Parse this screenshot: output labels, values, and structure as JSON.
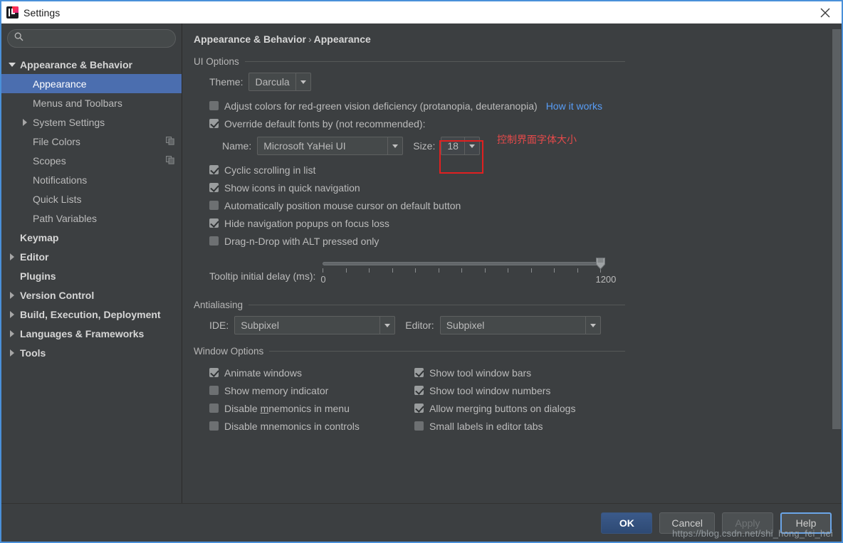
{
  "window": {
    "title": "Settings",
    "app_icon": "intellij-idea-icon",
    "close_icon": "close-icon",
    "accent_border": "#4a90d9"
  },
  "sidebar": {
    "search": {
      "value": "",
      "placeholder": "",
      "icon": "search-icon"
    },
    "items": [
      {
        "label": "Appearance & Behavior",
        "indent": 0,
        "twisty": "down",
        "bold": true,
        "selected": false,
        "icon": null
      },
      {
        "label": "Appearance",
        "indent": 1,
        "twisty": "none",
        "bold": false,
        "selected": true,
        "icon": null
      },
      {
        "label": "Menus and Toolbars",
        "indent": 1,
        "twisty": "none",
        "bold": false,
        "selected": false,
        "icon": null
      },
      {
        "label": "System Settings",
        "indent": 1,
        "twisty": "right",
        "bold": false,
        "selected": false,
        "icon": null
      },
      {
        "label": "File Colors",
        "indent": 1,
        "twisty": "none",
        "bold": false,
        "selected": false,
        "icon": "copy-icon"
      },
      {
        "label": "Scopes",
        "indent": 1,
        "twisty": "none",
        "bold": false,
        "selected": false,
        "icon": "copy-icon"
      },
      {
        "label": "Notifications",
        "indent": 1,
        "twisty": "none",
        "bold": false,
        "selected": false,
        "icon": null
      },
      {
        "label": "Quick Lists",
        "indent": 1,
        "twisty": "none",
        "bold": false,
        "selected": false,
        "icon": null
      },
      {
        "label": "Path Variables",
        "indent": 1,
        "twisty": "none",
        "bold": false,
        "selected": false,
        "icon": null
      },
      {
        "label": "Keymap",
        "indent": 0,
        "twisty": "none",
        "bold": true,
        "selected": false,
        "icon": null
      },
      {
        "label": "Editor",
        "indent": 0,
        "twisty": "right",
        "bold": true,
        "selected": false,
        "icon": null
      },
      {
        "label": "Plugins",
        "indent": 0,
        "twisty": "none",
        "bold": true,
        "selected": false,
        "icon": null
      },
      {
        "label": "Version Control",
        "indent": 0,
        "twisty": "right",
        "bold": true,
        "selected": false,
        "icon": null
      },
      {
        "label": "Build, Execution, Deployment",
        "indent": 0,
        "twisty": "right",
        "bold": true,
        "selected": false,
        "icon": null
      },
      {
        "label": "Languages & Frameworks",
        "indent": 0,
        "twisty": "right",
        "bold": true,
        "selected": false,
        "icon": null
      },
      {
        "label": "Tools",
        "indent": 0,
        "twisty": "right",
        "bold": true,
        "selected": false,
        "icon": null
      }
    ]
  },
  "breadcrumb": {
    "root": "Appearance & Behavior",
    "separator": "›",
    "leaf": "Appearance"
  },
  "ui_options": {
    "group_title": "UI Options",
    "theme_label": "Theme:",
    "theme_value": "Darcula",
    "adjust_colors": {
      "label": "Adjust colors for red-green vision deficiency (protanopia, deuteranopia)",
      "checked": false
    },
    "how_it_works_link": "How it works",
    "override_fonts": {
      "label": "Override default fonts by (not recommended):",
      "checked": true
    },
    "name_label": "Name:",
    "name_value": "Microsoft YaHei UI",
    "size_label": "Size:",
    "size_value": "18",
    "checkboxes": [
      {
        "label": "Cyclic scrolling in list",
        "checked": true,
        "mnemonic": ""
      },
      {
        "label": "Show icons in quick navigation",
        "checked": true,
        "mnemonic": ""
      },
      {
        "label": "Automatically position mouse cursor on default button",
        "checked": false,
        "mnemonic": ""
      },
      {
        "label": "Hide navigation popups on focus loss",
        "checked": true,
        "mnemonic": ""
      },
      {
        "label": "Drag-n-Drop with ALT pressed only",
        "checked": false,
        "mnemonic": ""
      }
    ],
    "tooltip_delay": {
      "label": "Tooltip initial delay (ms):",
      "min": "0",
      "max": "1200",
      "value": 1200
    }
  },
  "antialiasing": {
    "group_title": "Antialiasing",
    "ide_label": "IDE:",
    "ide_value": "Subpixel",
    "editor_label": "Editor:",
    "editor_value": "Subpixel"
  },
  "window_options": {
    "group_title": "Window Options",
    "left_column": [
      {
        "label": "Animate windows",
        "checked": true,
        "mnemonic": ""
      },
      {
        "label": "Show memory indicator",
        "checked": false,
        "mnemonic": ""
      },
      {
        "label": "Disable mnemonics in menu",
        "checked": false,
        "mnemonic": "m"
      },
      {
        "label": "Disable mnemonics in controls",
        "checked": false,
        "mnemonic": ""
      }
    ],
    "right_column": [
      {
        "label": "Show tool window bars",
        "checked": true,
        "mnemonic": ""
      },
      {
        "label": "Show tool window numbers",
        "checked": true,
        "mnemonic": ""
      },
      {
        "label": "Allow merging buttons on dialogs",
        "checked": true,
        "mnemonic": ""
      },
      {
        "label": "Small labels in editor tabs",
        "checked": false,
        "mnemonic": ""
      }
    ]
  },
  "annotation": {
    "text": "控制界面字体大小",
    "color": "#e02020"
  },
  "footer": {
    "ok": "OK",
    "cancel": "Cancel",
    "apply": "Apply",
    "help": "Help"
  },
  "watermark": "https://blog.csdn.net/shi_hong_fei_hei"
}
